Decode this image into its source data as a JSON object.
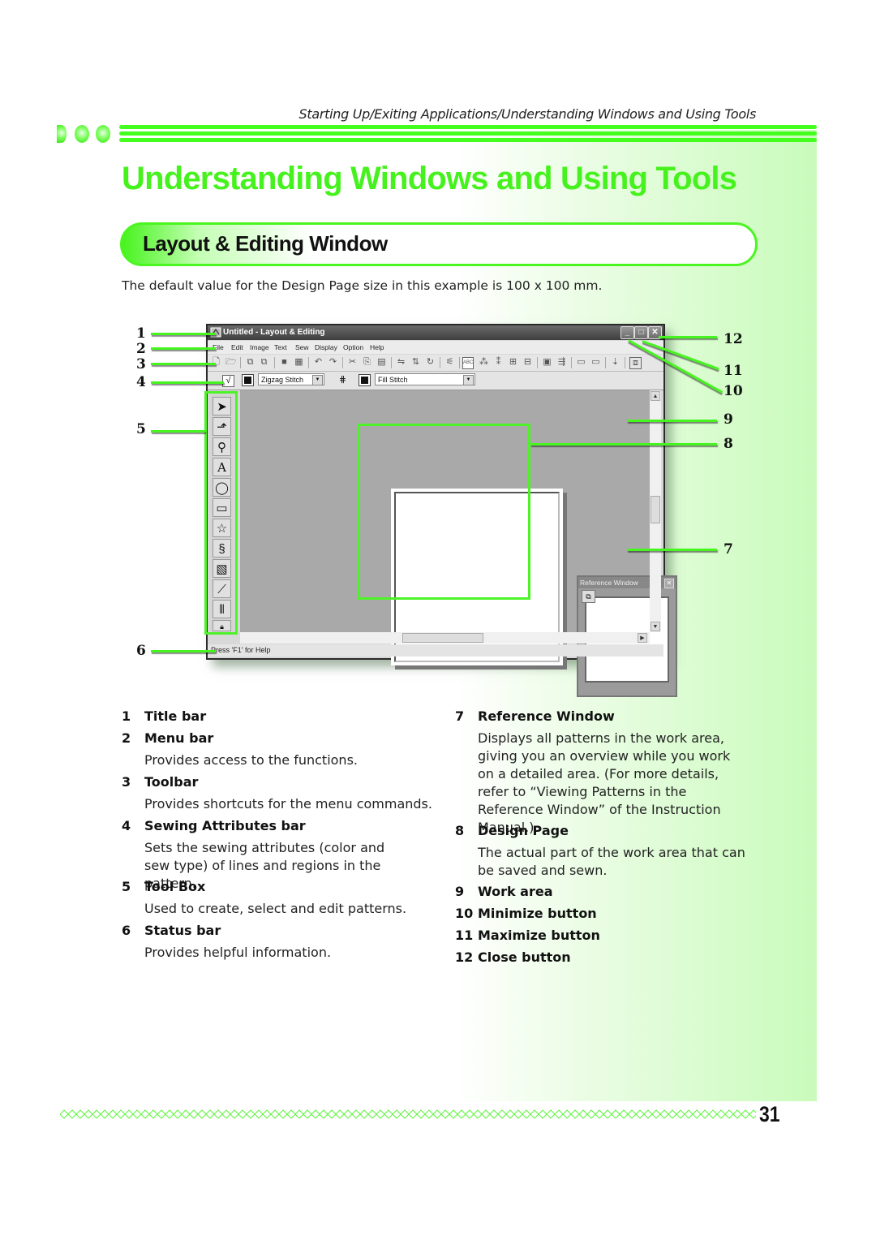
{
  "running_header": "Starting Up/Exiting Applications/Understanding Windows and Using Tools",
  "page_title": "Understanding Windows and Using Tools",
  "section_title": "Layout & Editing Window",
  "intro": "The default value for the Design Page size in this example is 100 x 100 mm.",
  "colors": {
    "accent_green": "#46f21d",
    "highlight_green": "#4df328",
    "bg_gradient_end": "#c9fbbb"
  },
  "app_window": {
    "title": "Untitled - Layout & Editing",
    "app_icon": "embroidery-app-icon",
    "window_buttons": {
      "minimize": "_",
      "maximize": "□",
      "close": "✕"
    },
    "menu": [
      "File",
      "Edit",
      "Image",
      "Text",
      "Sew",
      "Display",
      "Option",
      "Help"
    ],
    "toolbar_icons": [
      "new-icon",
      "open-icon",
      "import-icon",
      "import2-icon",
      "save-icon",
      "save-as-icon",
      "undo-icon",
      "redo-icon",
      "cut-icon",
      "copy-icon",
      "paste-icon",
      "mirror-icon",
      "flip-icon",
      "rotate-icon",
      "wand-icon",
      "text-abc-icon",
      "stitch-icon",
      "stitch2-icon",
      "layout-icon",
      "layout2-icon",
      "card-icon",
      "transfer-icon",
      "preview-icon",
      "monitor-icon",
      "properties-icon",
      "reference-window-icon"
    ],
    "sewing_attributes": {
      "line_sew_type": "Zigzag Stitch",
      "region_sew_type": "Fill Stitch"
    },
    "toolbox": [
      "select-arrow-icon",
      "point-edit-icon",
      "zoom-icon",
      "text-tool-icon",
      "outline-shape-icon",
      "rectangle-shape-icon",
      "heart-star-shape-icon",
      "brush-icon",
      "stamp-icon",
      "sewing-stitch-icon",
      "manual-punch-icon",
      "lock-icon"
    ],
    "reference_window_title": "Reference Window",
    "status_text": "Press 'F1' for Help"
  },
  "callouts": [
    "1",
    "2",
    "3",
    "4",
    "5",
    "6",
    "7",
    "8",
    "9",
    "10",
    "11",
    "12"
  ],
  "legend_left": [
    {
      "num": "1",
      "title": "Title bar",
      "desc": ""
    },
    {
      "num": "2",
      "title": "Menu bar",
      "desc": "Provides access to the functions."
    },
    {
      "num": "3",
      "title": "Toolbar",
      "desc": "Provides shortcuts for the menu commands."
    },
    {
      "num": "4",
      "title": "Sewing Attributes bar",
      "desc": "Sets the sewing attributes (color and sew type) of lines and regions in the pattern."
    },
    {
      "num": "5",
      "title": "Tool Box",
      "desc": "Used to create, select and edit patterns."
    },
    {
      "num": "6",
      "title": "Status bar",
      "desc": "Provides helpful information."
    }
  ],
  "legend_right": [
    {
      "num": "7",
      "title": "Reference Window",
      "desc": "Displays all patterns in the work area, giving you an overview while you work on a detailed area. (For more details, refer to “Viewing Patterns in the Reference Window” of the Instruction Manual.)"
    },
    {
      "num": "8",
      "title": "Design Page",
      "desc": "The actual part of the work area that can be saved and sewn."
    },
    {
      "num": "9",
      "title": "Work area",
      "desc": ""
    },
    {
      "num": "10",
      "title": "Minimize button",
      "desc": ""
    },
    {
      "num": "11",
      "title": "Maximize button",
      "desc": ""
    },
    {
      "num": "12",
      "title": "Close button",
      "desc": ""
    }
  ],
  "page_number": "31"
}
